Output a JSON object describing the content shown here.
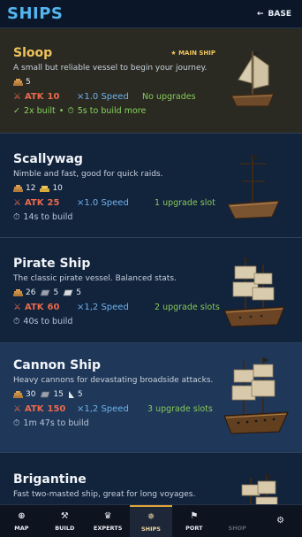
{
  "header": {
    "title": "SHIPS",
    "back_label": "BASE",
    "back_arrow": "←"
  },
  "ships": [
    {
      "name": "Sloop",
      "badge": "MAIN SHIP",
      "description": "A small but reliable vessel to begin your journey.",
      "resources": [
        {
          "icon": "wood-icon",
          "amount": "5"
        }
      ],
      "atk_label": "ATK",
      "atk": "10",
      "speed": "×1.0 Speed",
      "upgrades": "No upgrades",
      "built": "2x built",
      "build_more": "5s to build more"
    },
    {
      "name": "Scallywag",
      "description": "Nimble and fast, good for quick raids.",
      "resources": [
        {
          "icon": "wood-icon",
          "amount": "12"
        },
        {
          "icon": "gold-icon",
          "amount": "10"
        }
      ],
      "atk_label": "ATK",
      "atk": "25",
      "speed": "×1.0 Speed",
      "upgrades": "1 upgrade slot",
      "build_time": "14s to build"
    },
    {
      "name": "Pirate Ship",
      "description": "The classic pirate vessel. Balanced stats.",
      "resources": [
        {
          "icon": "wood-icon",
          "amount": "26"
        },
        {
          "icon": "iron-icon",
          "amount": "5"
        },
        {
          "icon": "silver-icon",
          "amount": "5"
        }
      ],
      "atk_label": "ATK",
      "atk": "60",
      "speed": "×1,2 Speed",
      "upgrades": "2 upgrade slots",
      "build_time": "40s to build"
    },
    {
      "name": "Cannon Ship",
      "description": "Heavy cannons for devastating broadside attacks.",
      "resources": [
        {
          "icon": "wood-icon",
          "amount": "30"
        },
        {
          "icon": "iron-icon",
          "amount": "15"
        },
        {
          "icon": "sail-icon",
          "amount": "5"
        }
      ],
      "atk_label": "ATK",
      "atk": "150",
      "speed": "×1,2 Speed",
      "upgrades": "3 upgrade slots",
      "build_time": "1m 47s to build"
    },
    {
      "name": "Brigantine",
      "description": "Fast two-masted ship, great for long voyages."
    }
  ],
  "nav": [
    {
      "label": "MAP",
      "icon": "⊕"
    },
    {
      "label": "BUILD",
      "icon": "⚒"
    },
    {
      "label": "EXPERTS",
      "icon": "♛"
    },
    {
      "label": "SHIPS",
      "icon": "✵"
    },
    {
      "label": "PORT",
      "icon": "⚑"
    },
    {
      "label": "SHOP",
      "icon": ""
    },
    {
      "label": "",
      "icon": "⚙"
    }
  ],
  "colors": {
    "accent": "#53b6ef",
    "atk": "#e8694d",
    "speed": "#6db4f0",
    "upgrade": "#86c95a",
    "gold": "#f0c45a"
  }
}
